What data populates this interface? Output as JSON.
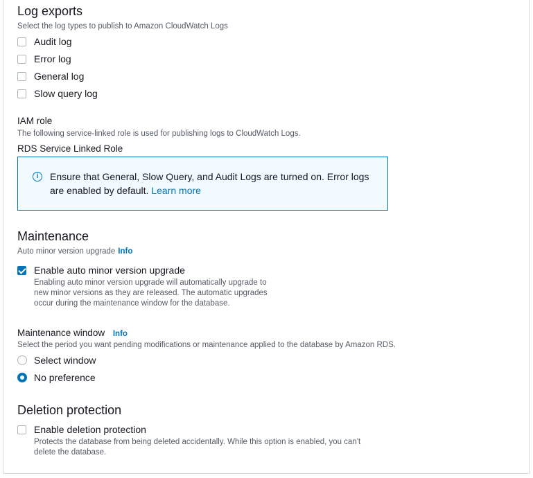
{
  "log_exports": {
    "title": "Log exports",
    "description": "Select the log types to publish to Amazon CloudWatch Logs",
    "options": [
      {
        "label": "Audit log",
        "checked": false
      },
      {
        "label": "Error log",
        "checked": false
      },
      {
        "label": "General log",
        "checked": false
      },
      {
        "label": "Slow query log",
        "checked": false
      }
    ]
  },
  "iam_role": {
    "title": "IAM role",
    "description": "The following service-linked role is used for publishing logs to CloudWatch Logs.",
    "role_name": "RDS Service Linked Role"
  },
  "info_box": {
    "icon": "info-icon",
    "text_line1": "Ensure that General, Slow Query, and Audit Logs are turned on. Error logs",
    "text_line2": "are enabled by default.",
    "link": "Learn more"
  },
  "maintenance": {
    "title": "Maintenance",
    "auto_upgrade_label": "Auto minor version upgrade",
    "info": "Info",
    "enable_label": "Enable auto minor version upgrade",
    "enable_checked": true,
    "enable_desc_1": "Enabling auto minor version upgrade will automatically upgrade to",
    "enable_desc_2": "new minor versions as they are released. The automatic upgrades",
    "enable_desc_3": "occur during the maintenance window for the database.",
    "window_label": "Maintenance window",
    "window_info": "Info",
    "window_desc": "Select the period you want pending modifications or maintenance applied to the database by Amazon RDS.",
    "window_options": [
      {
        "label": "Select window",
        "selected": false
      },
      {
        "label": "No preference",
        "selected": true
      }
    ]
  },
  "deletion": {
    "title": "Deletion protection",
    "enable_label": "Enable deletion protection",
    "enable_checked": false,
    "desc_1": "Protects the database from being deleted accidentally. While this option is enabled, you can't",
    "desc_2": "delete the database."
  },
  "colors": {
    "accent": "#0073bb",
    "info_bg": "#f1faff"
  }
}
